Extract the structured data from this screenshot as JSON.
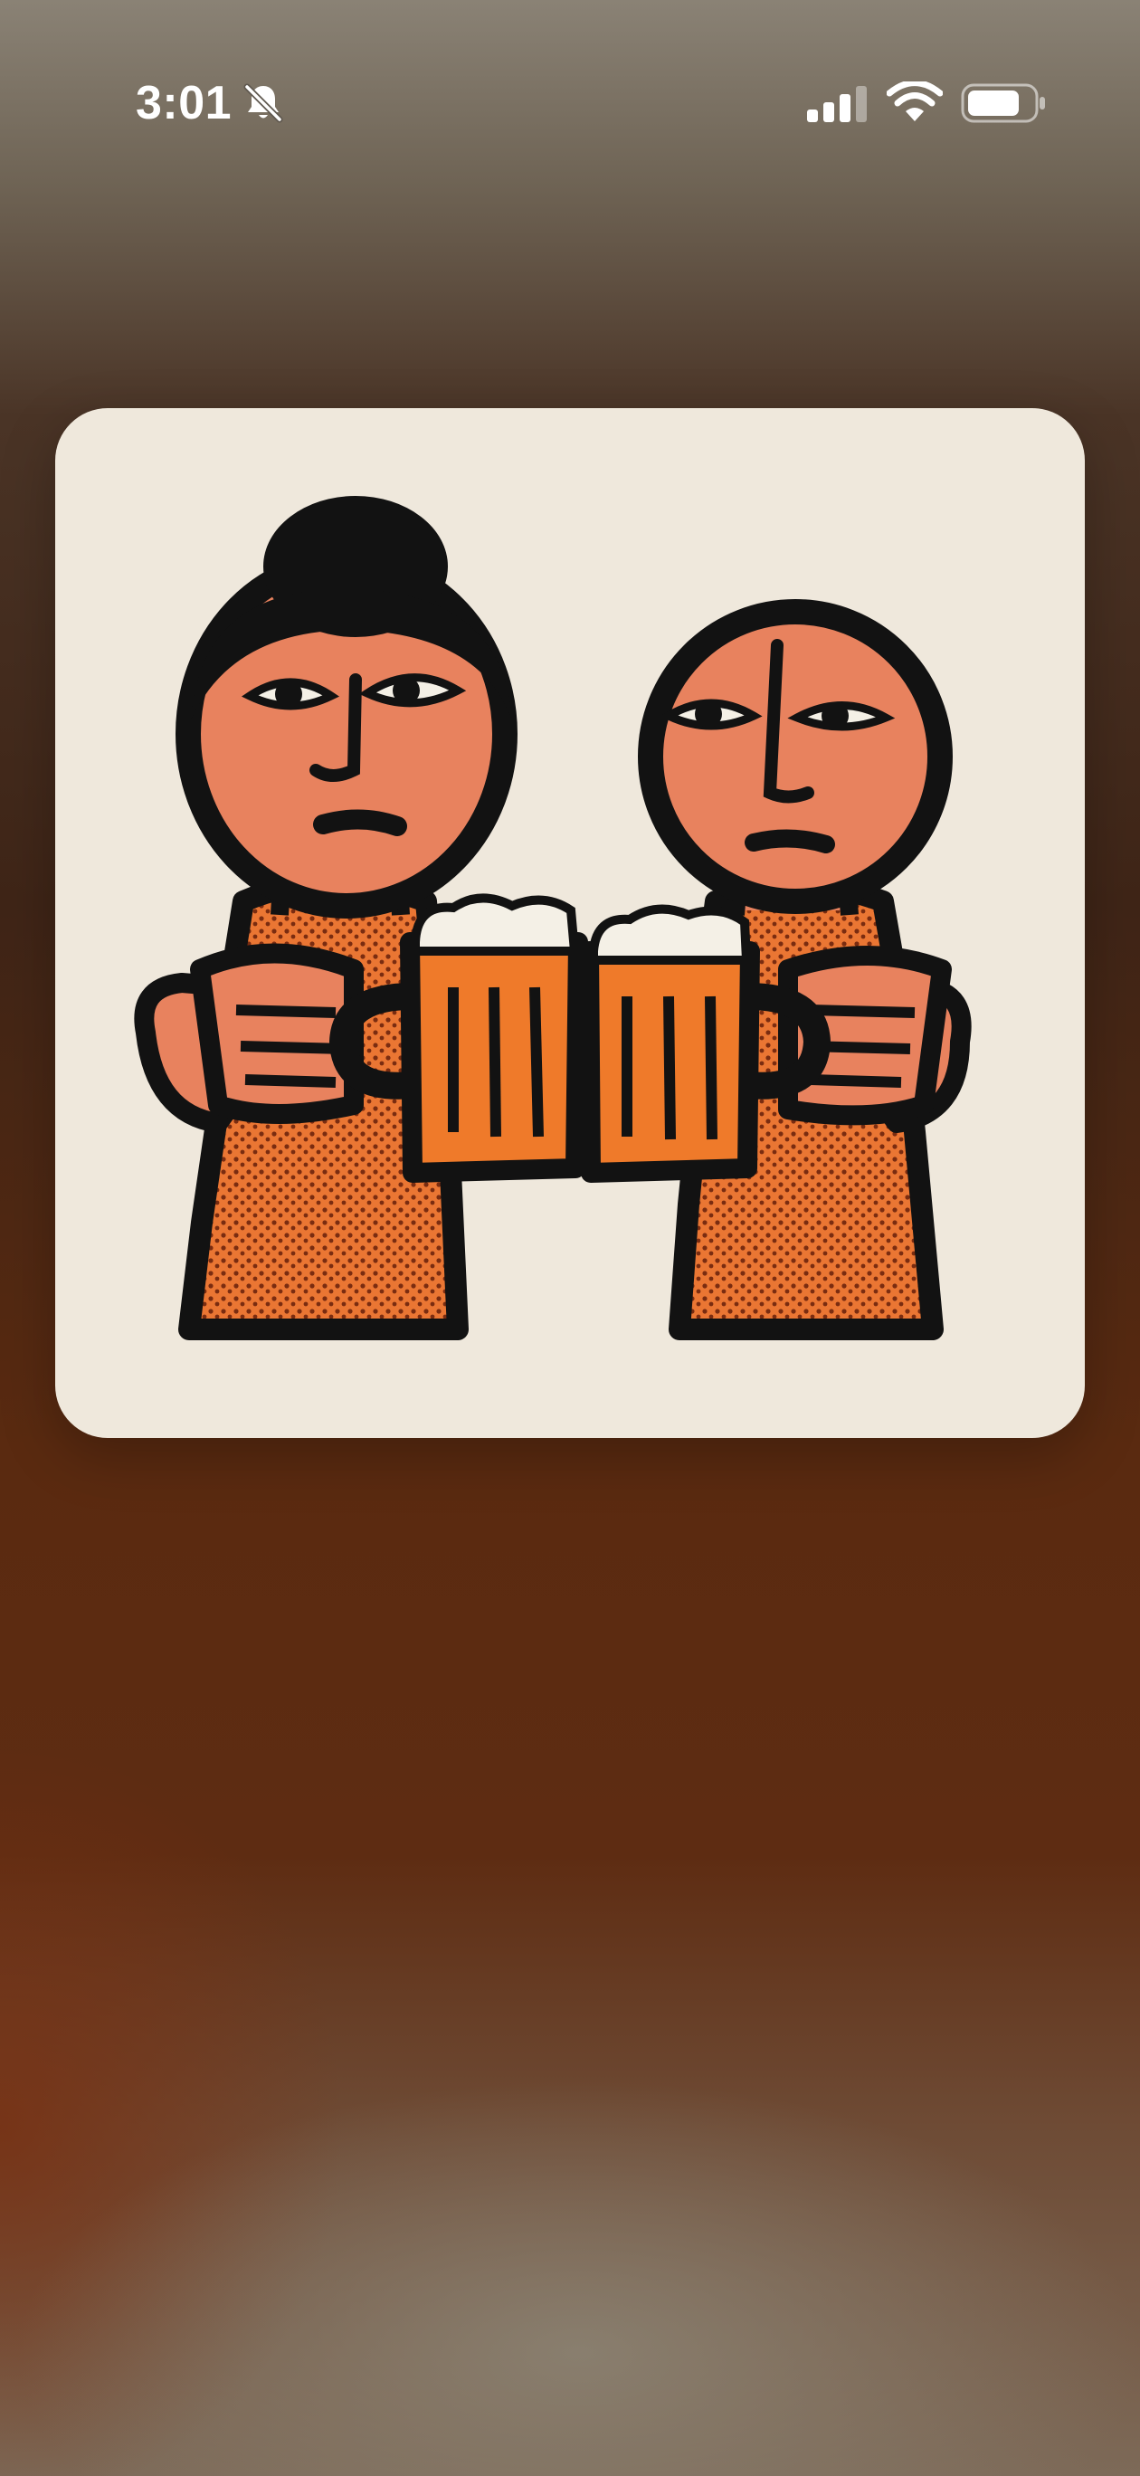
{
  "status_bar": {
    "time": "3:01",
    "icons": {
      "silent_mode": "bell-slash-icon",
      "cellular": "cellular-signal-icon",
      "wifi": "wifi-icon",
      "battery": "battery-icon"
    },
    "signal_bars_active": 3,
    "signal_bars_total": 4,
    "battery_level": 0.8
  },
  "artwork": {
    "subject": "two-people-toasting-beer-mugs",
    "colors": {
      "card_background": "#efe8dc",
      "skin": "#e8825e",
      "shirt": "#e8732e",
      "beer": "#ef7a2a",
      "ink": "#121212",
      "foam": "#f4f0e6"
    }
  }
}
